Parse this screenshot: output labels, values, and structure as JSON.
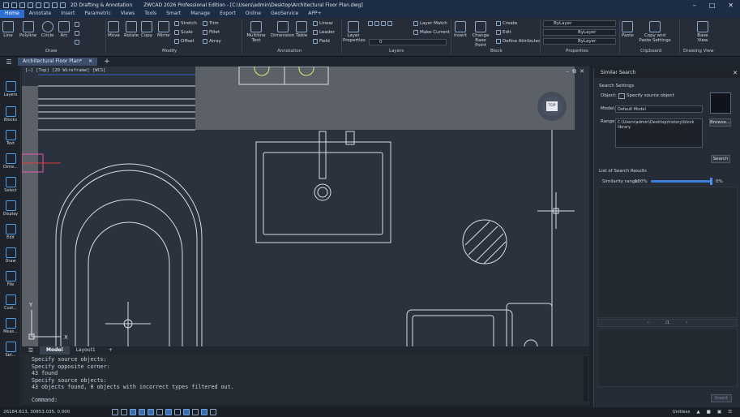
{
  "titlebar": {
    "workspace": "2D Drafting & Annotation",
    "title": "ZWCAD 2026 Professional Edition - [C:\\Users\\admin\\Desktop\\Architectural Floor Plan.dwg]"
  },
  "tabs": [
    "Home",
    "Annotate",
    "Insert",
    "Parametric",
    "Views",
    "Tools",
    "Smart",
    "Manage",
    "Export",
    "Online",
    "GeoService",
    "APP+"
  ],
  "ribbon": {
    "draw": {
      "line": "Line",
      "polyline": "Polyline",
      "circle": "Circle",
      "arc": "Arc",
      "label": "Draw"
    },
    "modify": {
      "move": "Move",
      "rotate": "Rotate",
      "copy": "Copy",
      "mirror": "Mirror",
      "stretch": "Stretch",
      "scale": "Scale",
      "offset": "Offset",
      "trim": "Trim",
      "fillet": "Fillet",
      "array": "Array",
      "label": "Modify"
    },
    "annotation": {
      "mtext": "Multiline Text",
      "dimension": "Dimension",
      "table": "Table",
      "linear": "Linear",
      "leader": "Leader",
      "field": "Field",
      "label": "Annotation"
    },
    "layers": {
      "props": "Layer Properties",
      "match": "Layer Match",
      "make_current": "Make Current",
      "current": "0",
      "label": "Layers"
    },
    "block": {
      "insert": "Insert",
      "change_base": "Change Base Point",
      "create": "Create",
      "edit": "Edit",
      "define_attr": "Define Attributes",
      "label": "Block"
    },
    "properties": {
      "color": "ByLayer",
      "linetype": "ByLayer",
      "lineweight": "ByLayer",
      "label": "Properties"
    },
    "clipboard": {
      "paste": "Paste",
      "copy_paste_settings": "Copy and Paste Settings",
      "label": "Clipboard"
    },
    "drawview": {
      "base_view": "Base View",
      "label": "Drawing View"
    }
  },
  "doc_tab": "Architectural Floor Plan*",
  "left_tools": [
    "Layers",
    "Blocks",
    "Text",
    "Dime...",
    "Select",
    "Display",
    "Edit",
    "Draw",
    "File",
    "Cust...",
    "Meas...",
    "Set..."
  ],
  "viewport": {
    "label": "[−] [Top] [2D Wireframe] [WCS]",
    "viewcube": "TOP"
  },
  "layout_tabs": [
    "Model",
    "Layout1"
  ],
  "command": {
    "lines": [
      "Specify source objects:",
      "Specify opposite corner:",
      "43 found",
      "Specify source objects:",
      "43 objects found, 0 objects with incorrect types filtered out."
    ],
    "prompt": "Command:"
  },
  "status": {
    "coords": "26184.613, 30853.035, 0.000",
    "style": "Unitless"
  },
  "palette": {
    "title": "Similar Search",
    "settings_label": "Search Settings",
    "object_label": "Object:",
    "object_value": "Specify source object",
    "model_label": "Model:",
    "model_value": "Default Model",
    "range_label": "Range:",
    "range_value": "C:\\Users\\admin\\Desktop\\history\\block library",
    "browse": "Browse...",
    "search": "Search",
    "results_label": "List of Search Results",
    "similarity_label": "Similarity range:",
    "sim_from": "100%",
    "sim_to": "0%",
    "page": "/1",
    "insert": "Insert"
  },
  "colors": {
    "accent": "#2f6fd1",
    "canvas": "#2a323d",
    "lines": "#d9dee5"
  }
}
